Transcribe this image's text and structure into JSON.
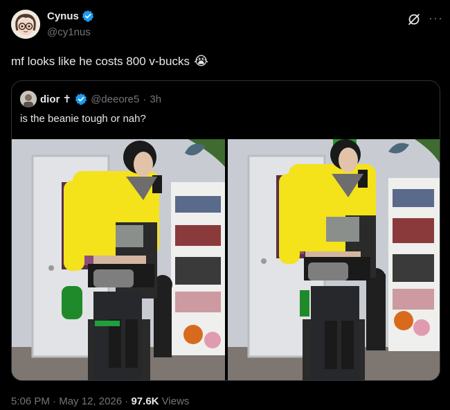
{
  "author": {
    "display_name": "Cynus",
    "handle": "@cy1nus",
    "avatar_icon": "avatar-illustration"
  },
  "tweet": {
    "text": "mf looks like he costs 800 v-bucks",
    "emoji": "😭"
  },
  "quoted": {
    "display_name": "dior ✝",
    "handle": "@deeore5",
    "separator": "·",
    "time": "3h",
    "text": "is the beanie tough or nah?",
    "photos": [
      {
        "description_icon": "mirror-selfie-photo"
      },
      {
        "description_icon": "mirror-selfie-photo"
      }
    ]
  },
  "footer": {
    "time": "5:06 PM",
    "separator1": "·",
    "date": "May 12, 2026",
    "separator2": "·",
    "views_count": "97.6K",
    "views_label": "Views"
  },
  "colors": {
    "background": "#000000",
    "text": "#e7e9ea",
    "secondary": "#71767b",
    "verified": "#1d9bf0",
    "border": "#2f3336"
  }
}
